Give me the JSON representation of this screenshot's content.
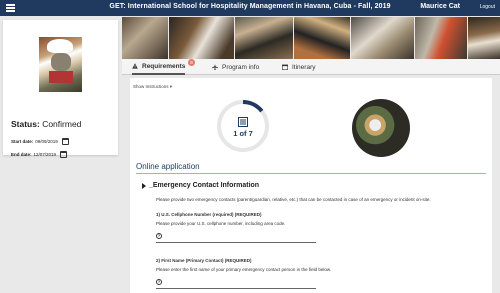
{
  "header": {
    "title": "GET: International School for Hospitality Management in Havana, Cuba - Fall, 2019",
    "user_name": "Maurice Cat",
    "logout_label": "Logout"
  },
  "sidebar": {
    "status_label": "Status:",
    "status_value": "Confirmed",
    "start_date_label": "Start date:",
    "start_date_value": "09/09/2019",
    "end_date_label": "End date:",
    "end_date_value": "12/07/2019"
  },
  "tabs": [
    {
      "label": "Requirements",
      "badge": "8",
      "icon": "warning-icon",
      "active": true
    },
    {
      "label": "Program info",
      "icon": "airplane-icon",
      "active": false
    },
    {
      "label": "Itinerary",
      "icon": "calendar-icon",
      "active": false
    }
  ],
  "main": {
    "show_instructions": "Show Instructions",
    "progress_label": "1 of 7",
    "progress_fraction": 0.142857,
    "section_title": "Online application",
    "form": {
      "heading": "_Emergency Contact Information",
      "intro": "Please provide two emergency contacts (parent/guardian, relative, etc.) that can be contacted in case of an emergency or incident on-site.",
      "q1_label": "1) U.S. Cellphone Number (required)  (REQUIRED)",
      "q1_desc": "Please provide your U.S. cellphone number, including area code.",
      "q2_label": "2) First Name (Primary Contact)  (REQUIRED)",
      "q2_desc": "Please enter the first name of your primary emergency contact person in the field below."
    }
  },
  "colors": {
    "header_bg": "#1f3a5e",
    "accent": "#1f3a5e",
    "badge": "#e07b6b"
  }
}
